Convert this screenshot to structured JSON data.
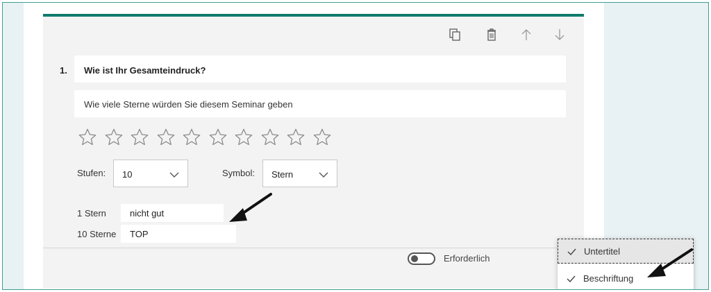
{
  "question": {
    "number": "1.",
    "title": "Wie ist Ihr Gesamteindruck?",
    "subtitle": "Wie viele Sterne würden Sie diesem Seminar geben"
  },
  "rating": {
    "star_count": 10,
    "levels_label": "Stufen:",
    "levels_value": "10",
    "symbol_label": "Symbol:",
    "symbol_value": "Stern",
    "min_label": "1 Stern",
    "min_value": "nicht gut",
    "max_label": "10 Sterne",
    "max_value": "TOP"
  },
  "footer": {
    "required_label": "Erforderlich",
    "required_on": false
  },
  "menu": {
    "items": [
      {
        "label": "Untertitel",
        "checked": true
      },
      {
        "label": "Beschriftung",
        "checked": true
      }
    ]
  },
  "colors": {
    "accent": "#0e7b6c",
    "frame_border": "#3c9e8f",
    "star_outline": "#8a8a8a"
  },
  "icons": [
    "copy-icon",
    "delete-icon",
    "arrow-up-icon",
    "arrow-down-icon",
    "star-icon",
    "chevron-down-icon",
    "check-icon"
  ]
}
